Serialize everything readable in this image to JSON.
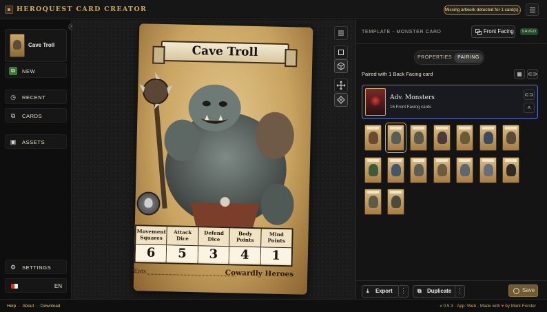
{
  "app": {
    "title": "HEROQUEST CARD CREATOR",
    "warning": "Missing artwork detected for 1 card(s)."
  },
  "sidebar": {
    "current_card_name": "Cave Troll",
    "new_label": "NEW",
    "recent_label": "RECENT",
    "cards_label": "CARDS",
    "assets_label": "ASSETS",
    "settings_label": "SETTINGS",
    "language": "EN"
  },
  "card": {
    "title": "Cave Troll",
    "stats": [
      {
        "label": "Movement Squares",
        "value": "6"
      },
      {
        "label": "Attack Dice",
        "value": "5"
      },
      {
        "label": "Defend Dice",
        "value": "3"
      },
      {
        "label": "Body Points",
        "value": "4"
      },
      {
        "label": "Mind Points",
        "value": "1"
      }
    ],
    "footer_left": "Eats",
    "footer_right": "Cowardly Heroes"
  },
  "panel": {
    "template_label": "TEMPLATE - MONSTER CARD",
    "facing_button": "Front Facing",
    "saved_badge": "SAVED",
    "tabs": [
      "PROPERTIES",
      "PAIRING"
    ],
    "active_tab": "PAIRING",
    "paired_text": "Paired with 1 Back Facing card",
    "deck_name": "Adv. Monsters",
    "deck_count": "16 Front Facing cards",
    "export_label": "Export",
    "duplicate_label": "Duplicate",
    "save_label": "Save"
  },
  "footer": {
    "help": "Help",
    "about": "About",
    "download": "Download",
    "version": "v 0.5.3",
    "app_mode": "App: Web",
    "made_with": "Made with",
    "by": "by Mark Forster"
  },
  "colors": {
    "accent_gold": "#d9a94e",
    "pairing_border": "#5b73c9",
    "saved_green": "#24482c",
    "new_green": "#3b7a3a"
  }
}
